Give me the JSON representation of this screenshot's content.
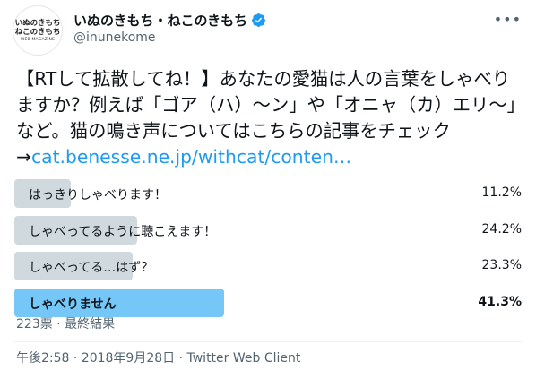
{
  "account": {
    "avatar_line1": "いぬのきもち",
    "avatar_line2": "ねこのきもち",
    "avatar_line3": "WEB MAGAZINE",
    "display_name": "いぬのきもち・ねこのきもち",
    "handle": "@inunekome",
    "verified": true,
    "more_icon": "more-options-icon"
  },
  "tweet": {
    "text": "【RTして拡散してね！】あなたの愛猫は人の言葉をしゃべりますか？例えば「ゴア（ハ）〜ン」や「オニャ（カ）エリ〜」など。猫の鳴き声についてはこちらの記事をチェック→",
    "link": "cat.benesse.ne.jp/withcat/conten…"
  },
  "poll": {
    "options": [
      {
        "label": "はっきりしゃべります！",
        "percent": "11.2%",
        "fraction": 0.112,
        "winner": false
      },
      {
        "label": "しゃべってるように聴こえます！",
        "percent": "24.2%",
        "fraction": 0.242,
        "winner": false
      },
      {
        "label": "しゃべってる…はず？",
        "percent": "23.3%",
        "fraction": 0.233,
        "winner": false
      },
      {
        "label": "しゃべりません",
        "percent": "41.3%",
        "fraction": 0.413,
        "winner": true
      }
    ],
    "summary": "223票 · 最終結果"
  },
  "timestamp": "午後2:58 · 2018年9月28日 · Twitter Web Client",
  "colors": {
    "bar": "#cfd9de",
    "winner_bar": "#74c7f7",
    "link": "#1d9bf0",
    "verified": "#1d9bf0"
  }
}
